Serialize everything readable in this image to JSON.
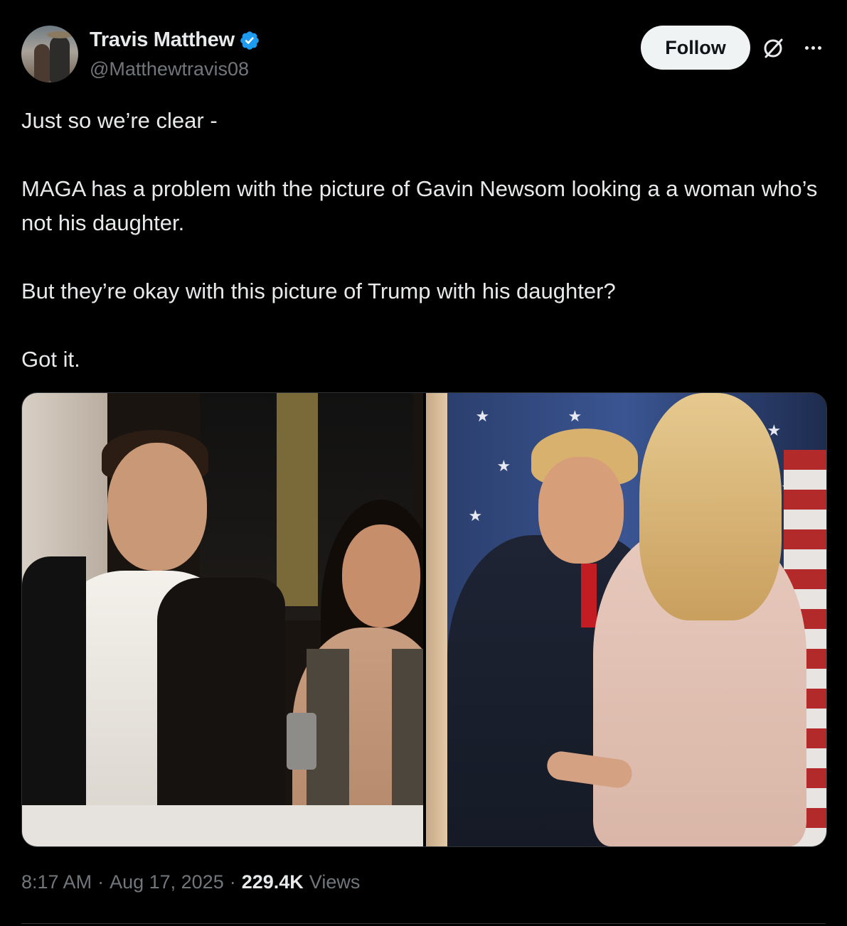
{
  "author": {
    "display_name": "Travis Matthew",
    "handle": "@Matthewtravis08",
    "verified": true,
    "verified_color": "#1d9bf0"
  },
  "actions": {
    "follow_label": "Follow",
    "grok_icon": "grok-icon",
    "more_icon": "more-icon"
  },
  "tweet": {
    "paragraphs": [
      "Just so we’re clear -",
      "MAGA has a problem with the picture of Gavin Newsom looking a a woman who’s not his daughter.",
      "But they’re okay with this picture of Trump with his daughter?",
      "Got it."
    ]
  },
  "media": {
    "count": 2
  },
  "meta": {
    "time": "8:17 AM",
    "separator1": "·",
    "date": "Aug 17, 2025",
    "separator2": "·",
    "views_count": "229.4K",
    "views_label": "Views"
  },
  "colors": {
    "background": "#000000",
    "text_primary": "#e7e9ea",
    "text_secondary": "#71767b",
    "follow_bg": "#eff3f4",
    "border": "#2f3336"
  }
}
